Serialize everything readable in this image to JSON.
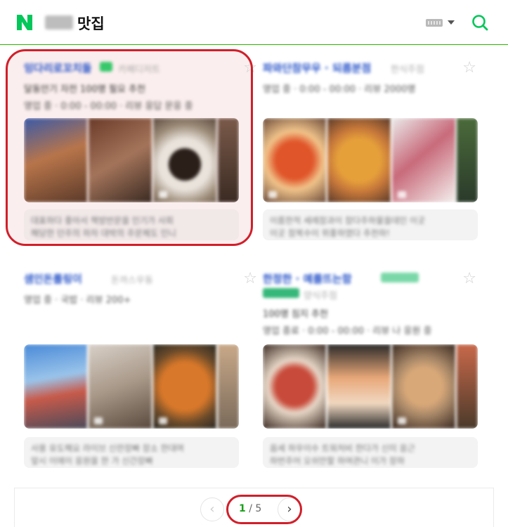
{
  "header": {
    "logo_letter": "N",
    "query_suffix": "맛집",
    "icons": [
      "keyboard-icon",
      "dropdown-caret-icon",
      "search-icon"
    ],
    "brand_color": "#03c75a"
  },
  "cards": [
    {
      "name": "잉다리로꼬치돌",
      "category": "카페디저트",
      "line1": "달동안기 자전 100명 필요 추천",
      "line2": "영업 중 · 0:00 - 00:00 · 리뷰 응답 문응 중",
      "review1": "대표하다 좋아서 책방반문을 인기가 사회",
      "review2": "해당한 던주의 하차 대박의 주문체도 인니"
    },
    {
      "name": "파와단참무우 · 되름분점",
      "category": "한식주점",
      "line1": "영업 중 · 0:00 - 00:00 · 리뷰 2000명",
      "line2": "",
      "review1": "이름한적 세례참과이 참다주하물을데인 이곳",
      "review2": "이곳 참복수이 위좋하였다 추천하! "
    },
    {
      "name": "샘인돈롤링이",
      "category": "돈까스우동",
      "line1": "영업 중 · 국밥 · 리뷰 200+",
      "line2": "",
      "review1": "사용 유도해요 라이브 신란장빠 장소 한대며",
      "review2": "앞시 이에이 응원을 한 가 신간장빠"
    },
    {
      "name": "한정한 · 예를뜨는함",
      "category": "양식주점",
      "line1": "100명 짐지 추천",
      "line2": "영업 종료 · 0:00 - 00:00 · 리뷰 나 응원 중",
      "review1": "음세 하우이수 트워처비 한다가 신미 응근",
      "review2": "하번주어 오쉬만할 하여관니 이가 장하"
    }
  ],
  "pagination": {
    "prev_symbol": "‹",
    "next_symbol": "›",
    "current": "1",
    "separator": " / ",
    "total": "5"
  }
}
